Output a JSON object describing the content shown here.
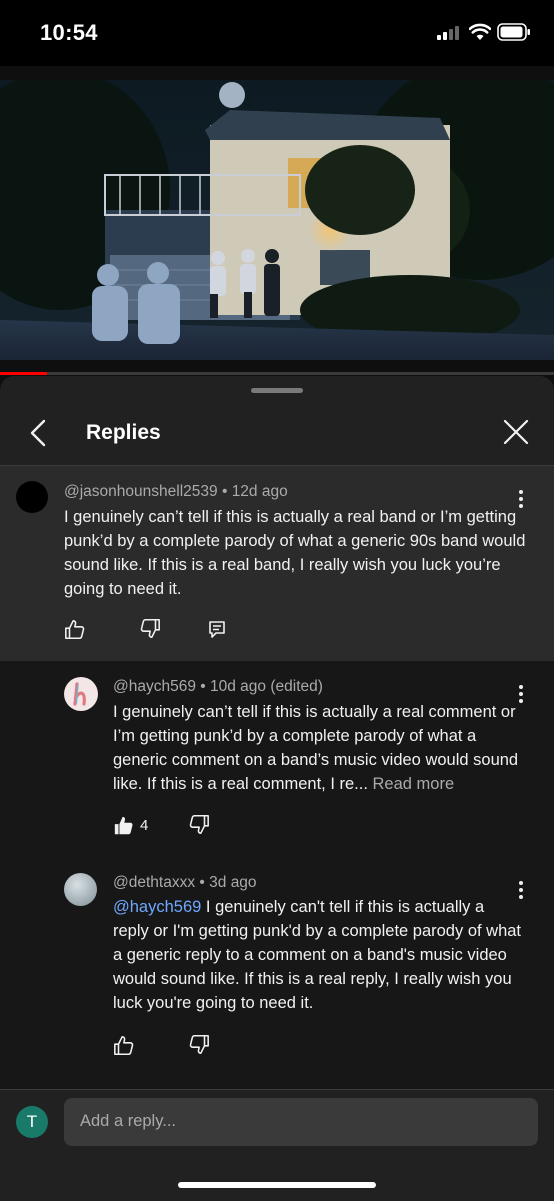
{
  "status": {
    "time": "10:54"
  },
  "video": {
    "progress": 0.085
  },
  "panel": {
    "title": "Replies"
  },
  "parent_comment": {
    "author": "@jasonhounshell2539",
    "age": "12d ago",
    "text": "I genuinely can’t tell if this is actually a real band or I’m getting punk’d by a complete parody of what a generic 90s band would sound like. If this is a real band, I really wish you luck you’re going to need it."
  },
  "replies": [
    {
      "author": "@haych569",
      "age": "10d ago (edited)",
      "text": "I genuinely can’t tell if this is actually a real comment or I’m getting punk’d by a complete parody of what a generic comment on a band’s music video would sound like. If this is a real comment, I re... ",
      "read_more": "Read more",
      "likes": "4"
    },
    {
      "author": "@dethtaxxx",
      "age": "3d ago",
      "mention": "@haych569",
      "text": " I genuinely can't tell if this is actually a reply or I'm getting punk'd by a complete parody of what a generic reply to a comment on a band's music video would sound like. If this is a real reply, I really wish you luck you're going to need it."
    }
  ],
  "composer": {
    "avatar_letter": "T",
    "placeholder": "Add a reply..."
  },
  "icons": [
    "back-chevron-icon",
    "close-icon",
    "like-icon",
    "dislike-icon",
    "reply-icon",
    "more-vert-icon"
  ],
  "colors": {
    "mention": "#6ea8ff",
    "progress": "#ff0000",
    "avatar_t": "#1a7a6a"
  }
}
